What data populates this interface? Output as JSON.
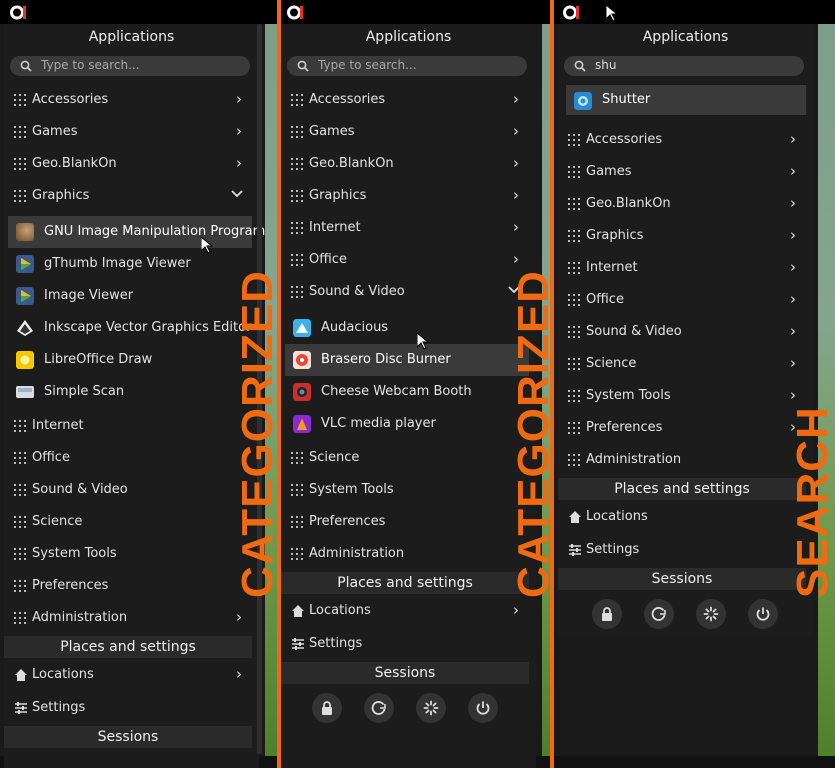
{
  "colors": {
    "accent": "#f06a12",
    "panel": "#1c1c1c",
    "highlight": "#3a3a3a",
    "section": "#2a2a2a"
  },
  "panel1": {
    "title": "Applications",
    "search_placeholder": "Type to search...",
    "categories_top": [
      "Accessories",
      "Games",
      "Geo.BlankOn",
      "Graphics"
    ],
    "expanded_apps": [
      "GNU Image Manipulation Program",
      "gThumb Image Viewer",
      "Image Viewer",
      "Inkscape Vector Graphics Editor",
      "LibreOffice Draw",
      "Simple Scan"
    ],
    "categories_bottom": [
      "Internet",
      "Office",
      "Sound & Video",
      "Science",
      "System Tools",
      "Preferences",
      "Administration"
    ],
    "places_header": "Places and settings",
    "places": [
      "Locations",
      "Settings"
    ],
    "sessions_header": "Sessions",
    "overlay_label": "CATEGORIZED"
  },
  "panel2": {
    "title": "Applications",
    "search_placeholder": "Type to search...",
    "categories_top": [
      "Accessories",
      "Games",
      "Geo.BlankOn",
      "Graphics",
      "Internet",
      "Office",
      "Sound & Video"
    ],
    "expanded_apps": [
      "Audacious",
      "Brasero Disc Burner",
      "Cheese Webcam Booth",
      "VLC media player"
    ],
    "categories_bottom": [
      "Science",
      "System Tools",
      "Preferences",
      "Administration"
    ],
    "places_header": "Places and settings",
    "places": [
      "Locations",
      "Settings"
    ],
    "sessions_header": "Sessions",
    "overlay_label": "CATEGORIZED"
  },
  "panel3": {
    "title": "Applications",
    "search_value": "shu",
    "result": "Shutter",
    "categories": [
      "Accessories",
      "Games",
      "Geo.BlankOn",
      "Graphics",
      "Internet",
      "Office",
      "Sound & Video",
      "Science",
      "System Tools",
      "Preferences",
      "Administration"
    ],
    "places_header": "Places and settings",
    "places": [
      "Locations",
      "Settings"
    ],
    "sessions_header": "Sessions",
    "overlay_label": "SEARCH"
  },
  "session_icons": [
    "lock-icon",
    "logout-icon",
    "suspend-icon",
    "power-icon"
  ]
}
